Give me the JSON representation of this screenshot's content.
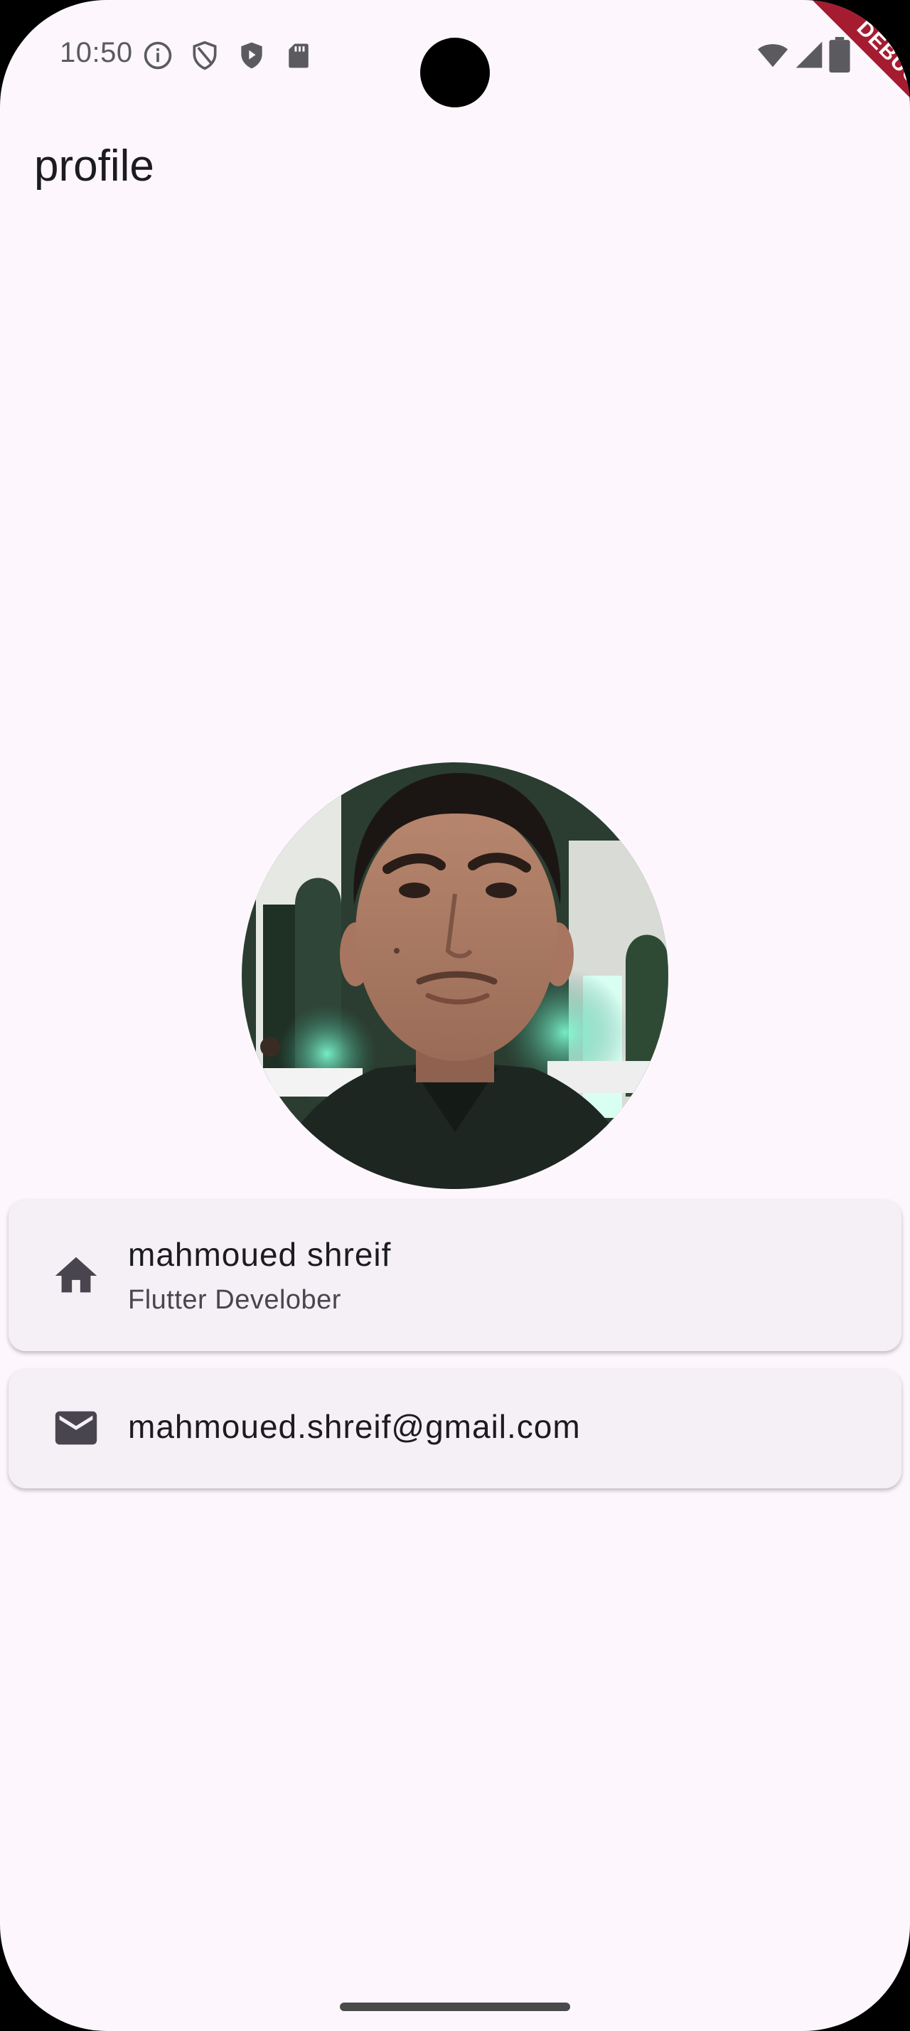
{
  "status_bar": {
    "time": "10:50",
    "left_icons": [
      "info-icon",
      "shield-outline-icon",
      "play-shield-icon",
      "sd-card-icon"
    ],
    "right_icons": [
      "wifi-icon",
      "signal-icon",
      "battery-icon"
    ]
  },
  "debug_banner": {
    "label": "DEBUG",
    "color": "#a51c30"
  },
  "app_bar": {
    "title": "profile"
  },
  "profile": {
    "avatar_description": "profile-photo"
  },
  "cards": [
    {
      "icon": "home-icon",
      "title": "mahmoued shreif",
      "subtitle": "Flutter Develober"
    },
    {
      "icon": "mail-icon",
      "title": "mahmoued.shreif@gmail.com"
    }
  ],
  "colors": {
    "background": "#fdf7fd",
    "card": "#f5f0f6",
    "text": "#1c1b1f"
  }
}
